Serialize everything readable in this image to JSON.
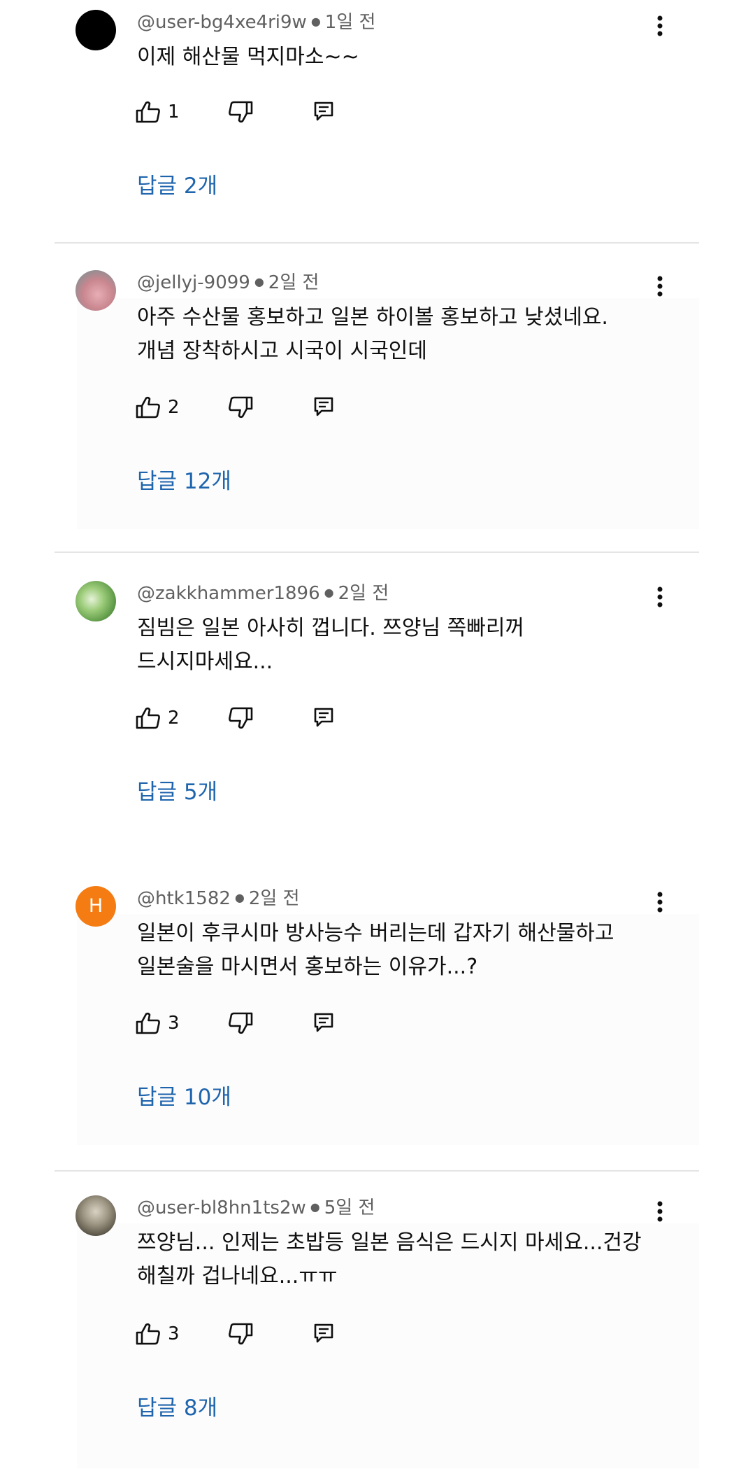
{
  "comments": [
    {
      "handle": "@user-bg4xe4ri9w",
      "time": "1일 전",
      "text": "이제 해산물 먹지마소~~",
      "likes": "1",
      "replies_label": "답글 2개",
      "avatar": "black-circle-avatar"
    },
    {
      "handle": "@jellyj-9099",
      "time": "2일 전",
      "text": "아주 수산물 홍보하고 일본 하이볼 홍보하고 낮셨네요.\n개념 장착하시고 시국이 시국인데",
      "likes": "2",
      "replies_label": "답글 12개",
      "avatar": "photo-avatar"
    },
    {
      "handle": "@zakkhammer1896",
      "time": "2일 전",
      "text": "짐빔은 일본 아사히 껍니다. 쯔양님 쪽빠리꺼\n드시지마세요...",
      "likes": "2",
      "replies_label": "답글 5개",
      "avatar": "photo-avatar"
    },
    {
      "handle": "@htk1582",
      "time": "2일 전",
      "text": "일본이 후쿠시마 방사능수 버리는데 갑자기 해산물하고\n일본술을 마시면서 홍보하는 이유가...?",
      "likes": "3",
      "replies_label": "답글 10개",
      "avatar_letter": "H"
    },
    {
      "handle": "@user-bl8hn1ts2w",
      "time": "5일 전",
      "text": "쯔양님... 인제는 초밥등 일본 음식은 드시지 마세요...건강\n해칠까 겁나네요...ㅠㅠ",
      "likes": "3",
      "replies_label": "답글 8개",
      "avatar": "photo-avatar"
    }
  ],
  "icons": {
    "like": "thumbs-up-icon",
    "dislike": "thumbs-down-icon",
    "reply": "comment-reply-icon",
    "more": "more-vert-icon"
  },
  "colors": {
    "link": "#1f65ad",
    "meta": "#606060",
    "avatar_letter_bg": "#f47c13"
  }
}
